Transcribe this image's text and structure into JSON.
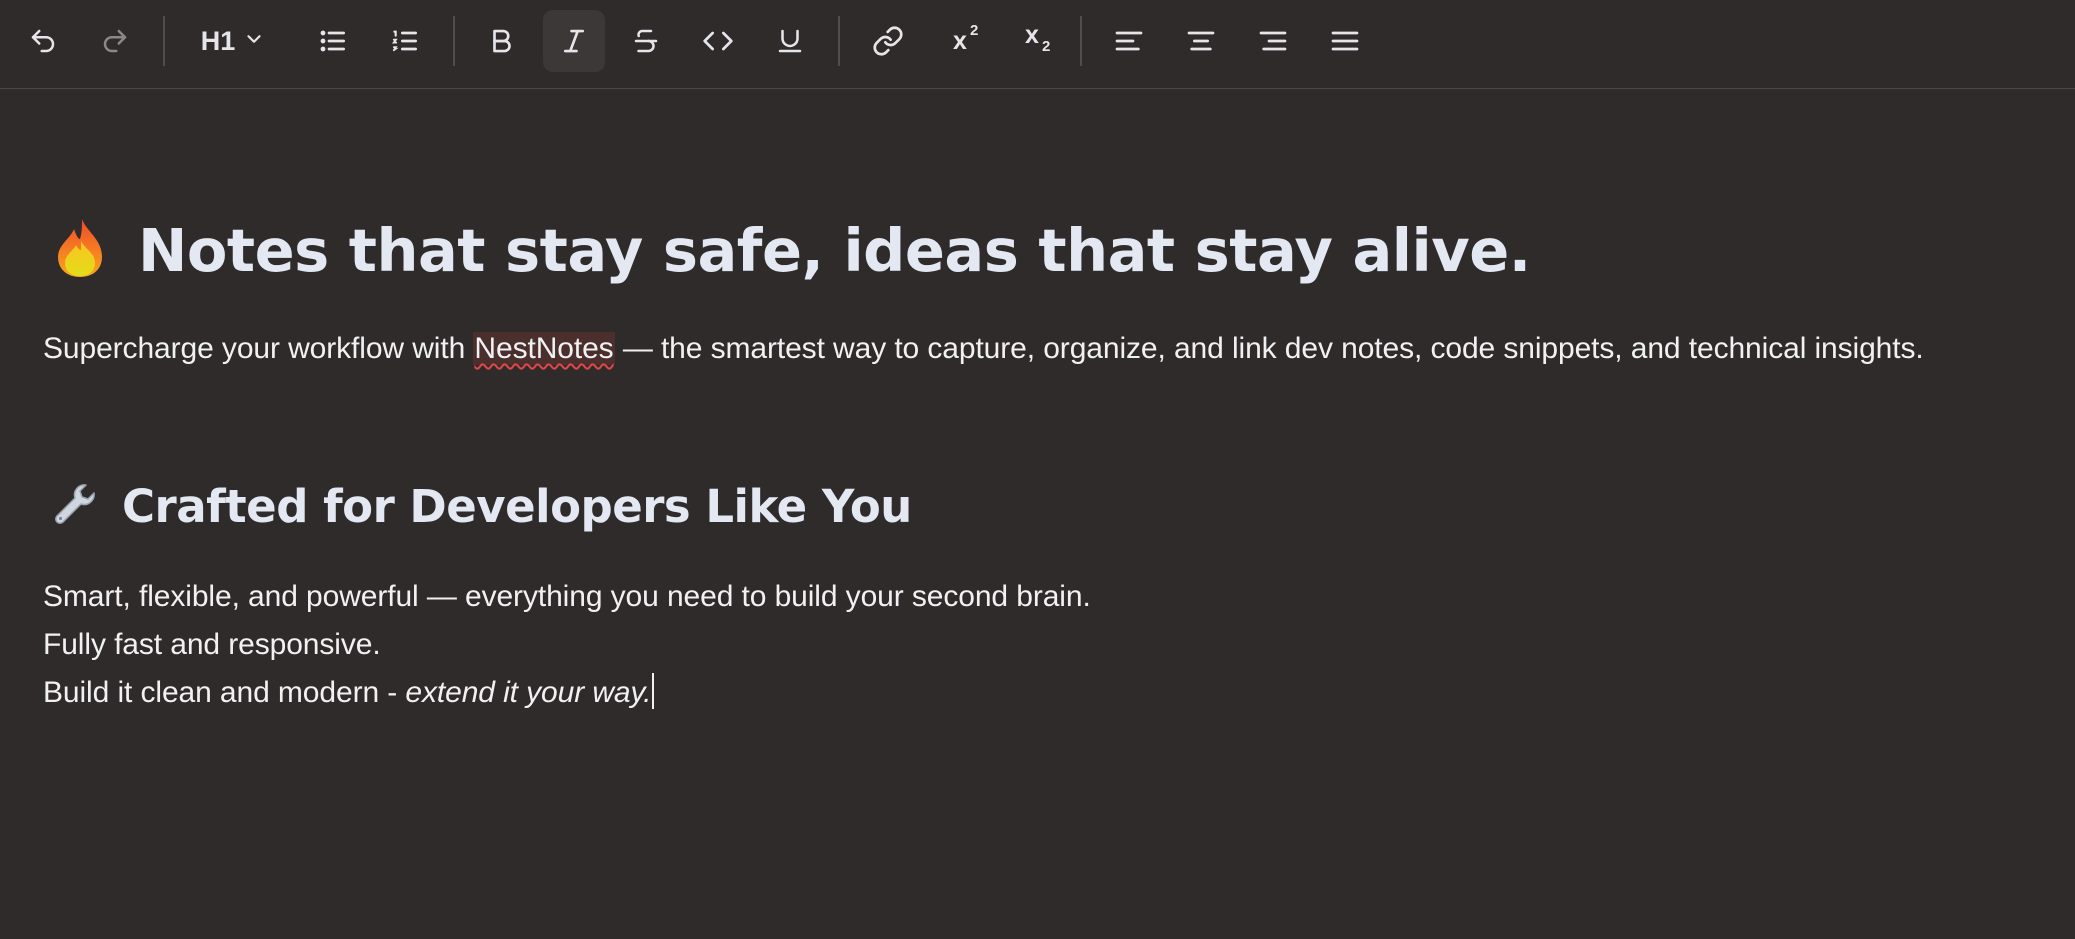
{
  "toolbar": {
    "undo_icon": "undo-icon",
    "redo_icon": "redo-icon",
    "heading_level": "H1",
    "bullet_list_icon": "bullet-list-icon",
    "ordered_list_icon": "ordered-list-icon",
    "bold_label": "B",
    "italic_label": "I",
    "strike_label": "S",
    "code_icon": "code-icon",
    "underline_label": "U",
    "link_icon": "link-icon",
    "superscript": {
      "base": "x",
      "mark": "2"
    },
    "subscript": {
      "base": "x",
      "mark": "2"
    },
    "align_left_icon": "align-left-icon",
    "align_center_icon": "align-center-icon",
    "align_right_icon": "align-right-icon",
    "align_justify_icon": "align-justify-icon",
    "active_format": "italic"
  },
  "document": {
    "heading1": {
      "icon": "fire-icon",
      "text": "Notes that stay safe, ideas that stay alive."
    },
    "intro": {
      "before": "Supercharge your workflow with ",
      "highlight": "NestNotes",
      "after": " — the smartest way to capture, organize, and link dev notes, code snippets, and technical insights."
    },
    "heading2": {
      "icon": "wrench-icon",
      "text": "Crafted for Developers Like You"
    },
    "line1": "Smart, flexible, and powerful — everything you need to build your second brain.",
    "line2": "Fully fast and responsive.",
    "line3": {
      "plain": "Build it clean and modern - ",
      "italic": "extend it your way."
    }
  },
  "colors": {
    "background": "#2f2b2b",
    "heading": "#e3e8f2",
    "text": "#f1f1f3",
    "spellcheck_underline": "#e04848",
    "active_button": "#3c3838"
  }
}
